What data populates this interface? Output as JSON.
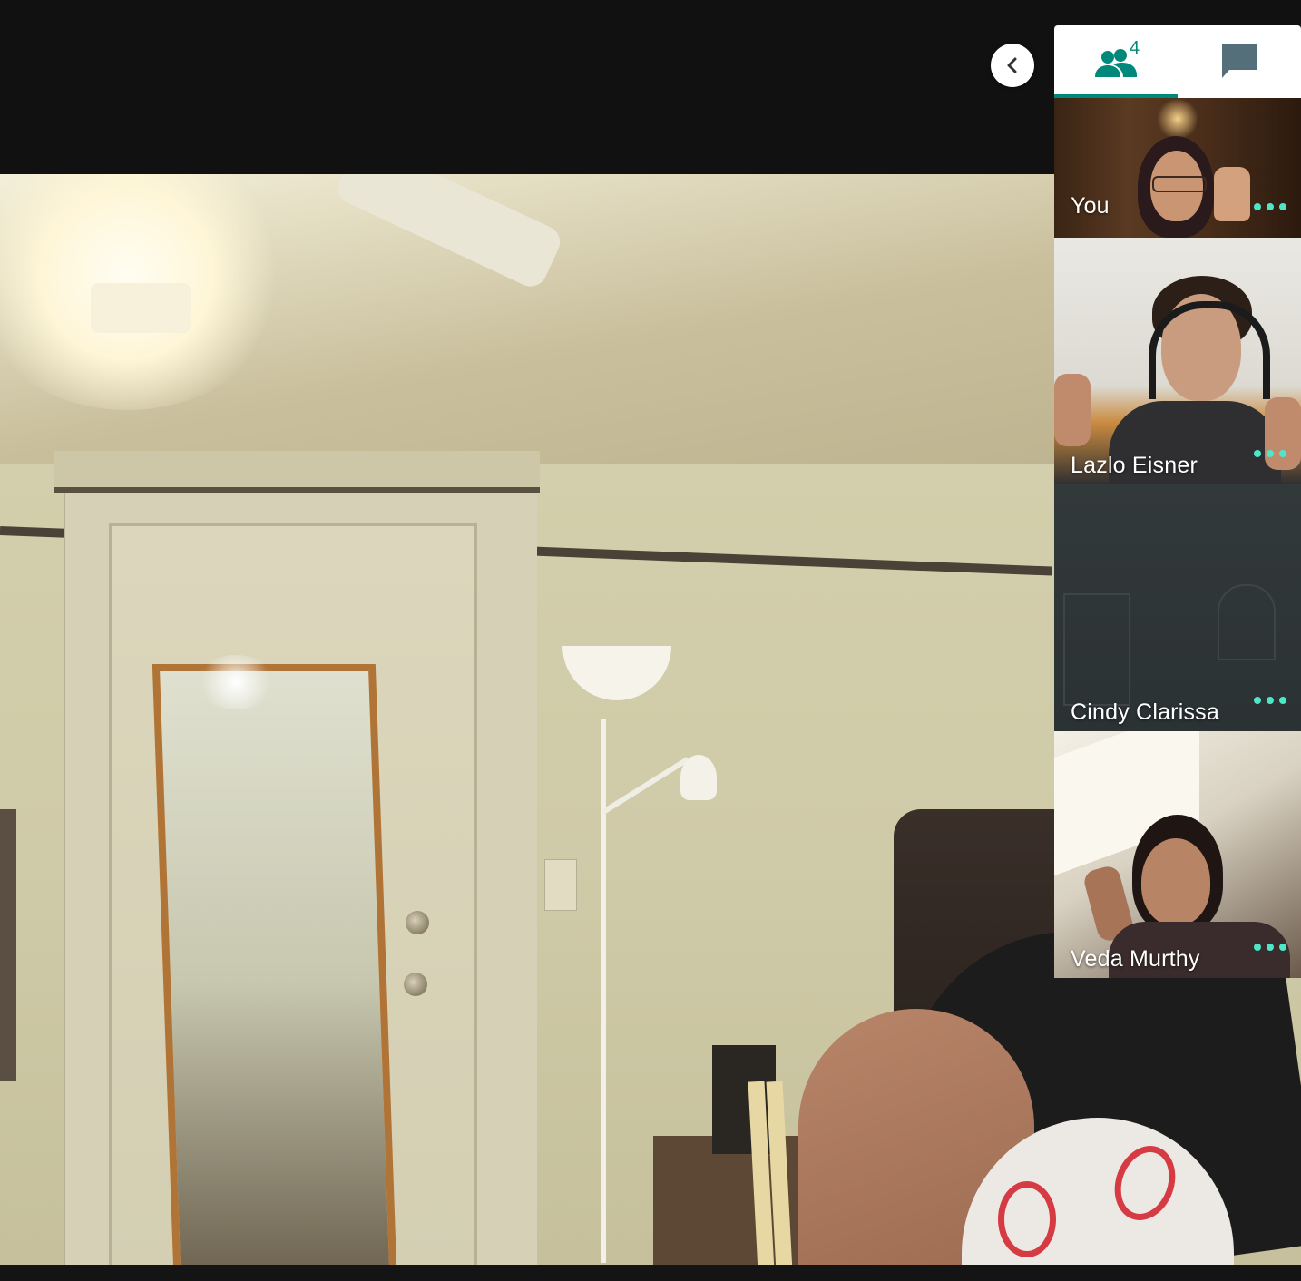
{
  "participants_tab": {
    "count": "4",
    "icon": "people-icon"
  },
  "chat_tab": {
    "icon": "chat-icon"
  },
  "collapse_button": {
    "icon": "chevron-left-icon"
  },
  "participants": [
    {
      "name": "You"
    },
    {
      "name": "Lazlo Eisner"
    },
    {
      "name": "Cindy Clarissa"
    },
    {
      "name": "Veda Murthy"
    }
  ],
  "colors": {
    "accent": "#00897b",
    "more_dots": "#4ee6c9"
  }
}
